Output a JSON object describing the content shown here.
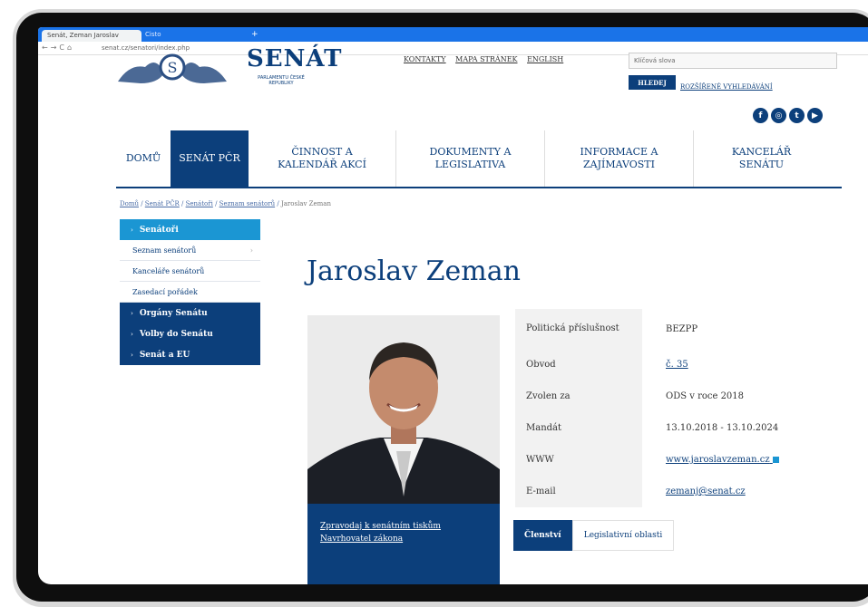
{
  "browser": {
    "tab_title": "Senát, Zeman Jaroslav",
    "tab_second": "Cisto",
    "url": "senat.cz/senatori/index.php"
  },
  "header": {
    "logo_title": "SENÁT",
    "logo_sub": "PARLAMENTU ČESKÉ REPUBLIKY",
    "toplinks": [
      "KONTAKTY",
      "MAPA STRÁNEK",
      "ENGLISH"
    ],
    "search_placeholder": "Klíčová slova",
    "search_button": "HLEDEJ",
    "advanced_search": "ROZŠÍŘENÉ VYHLEDÁVÁNÍ"
  },
  "mainnav": [
    "DOMŮ",
    "SENÁT PČR",
    "ČINNOST A KALENDÁŘ AKCÍ",
    "DOKUMENTY A LEGISLATIVA",
    "INFORMACE A ZAJÍMAVOSTI",
    "KANCELÁŘ SENÁTU"
  ],
  "breadcrumb": [
    "Domů",
    "Senát PČR",
    "Senátoři",
    "Seznam senátorů",
    "Jaroslav Zeman"
  ],
  "sidemenu": {
    "senatori": "Senátoři",
    "seznam": "Seznam senátorů",
    "kancelare": "Kanceláře senátorů",
    "zasedaci": "Zasedací pořádek",
    "organy": "Orgány Senátu",
    "volby": "Volby do Senátu",
    "eu": "Senát a EU"
  },
  "page_title": "Jaroslav Zeman",
  "photo_links": [
    "Zpravodaj k senátním tiskům",
    "Navrhovatel zákona"
  ],
  "info": [
    {
      "key": "Politická příslušnost",
      "value": "BEZPP"
    },
    {
      "key": "Obvod",
      "value": "č. 35"
    },
    {
      "key": "Zvolen za",
      "value": "ODS v roce 2018"
    },
    {
      "key": "Mandát",
      "value": "13.10.2018 - 13.10.2024"
    },
    {
      "key": "WWW",
      "value": "www.jaroslavzeman.cz"
    },
    {
      "key": "E-mail",
      "value": "zemanj@senat.cz"
    }
  ],
  "tabs": [
    "Členství",
    "Legislativní oblasti"
  ],
  "colors": {
    "primary": "#0c3f7b",
    "active_side": "#1b96d3",
    "chrome": "#1a73e8"
  }
}
